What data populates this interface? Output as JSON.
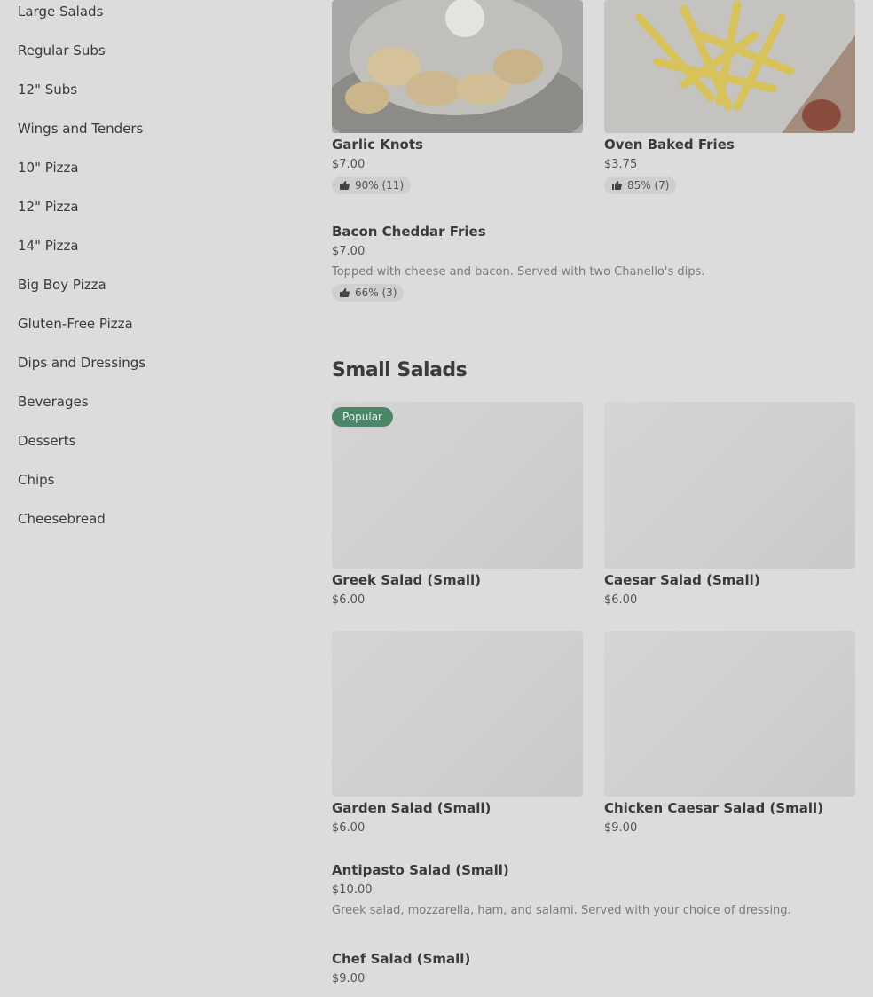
{
  "sidebar": {
    "items": [
      {
        "label": "Large Salads"
      },
      {
        "label": "Regular Subs"
      },
      {
        "label": "12\" Subs"
      },
      {
        "label": "Wings and Tenders"
      },
      {
        "label": "10\" Pizza"
      },
      {
        "label": "12\" Pizza"
      },
      {
        "label": "14\" Pizza"
      },
      {
        "label": "Big Boy Pizza"
      },
      {
        "label": "Gluten-Free Pizza"
      },
      {
        "label": "Dips and Dressings"
      },
      {
        "label": "Beverages"
      },
      {
        "label": "Desserts"
      },
      {
        "label": "Chips"
      },
      {
        "label": "Cheesebread"
      }
    ]
  },
  "sides": {
    "cards": [
      {
        "name": "Garlic Knots",
        "price": "$7.00",
        "rating": "90% (11)",
        "image": "garlic-knots-photo"
      },
      {
        "name": "Oven Baked Fries",
        "price": "$3.75",
        "rating": "85% (7)",
        "image": "fries-photo"
      }
    ],
    "list": [
      {
        "name": "Bacon Cheddar Fries",
        "price": "$7.00",
        "description": "Topped with cheese and bacon. Served with two Chanello's dips.",
        "rating": "66% (3)"
      }
    ]
  },
  "small_salads": {
    "title": "Small Salads",
    "badge": "Popular",
    "cards": [
      {
        "name": "Greek Salad (Small)",
        "price": "$6.00"
      },
      {
        "name": "Caesar Salad (Small)",
        "price": "$6.00"
      },
      {
        "name": "Garden Salad (Small)",
        "price": "$6.00"
      },
      {
        "name": "Chicken Caesar Salad (Small)",
        "price": "$9.00"
      }
    ],
    "list": [
      {
        "name": "Antipasto Salad (Small)",
        "price": "$10.00",
        "description": "Greek salad, mozzarella, ham, and salami. Served with your choice of dressing."
      },
      {
        "name": "Chef Salad (Small)",
        "price": "$9.00"
      }
    ]
  },
  "colors": {
    "background": "#dcdcdc",
    "badge": "#4b8767"
  }
}
